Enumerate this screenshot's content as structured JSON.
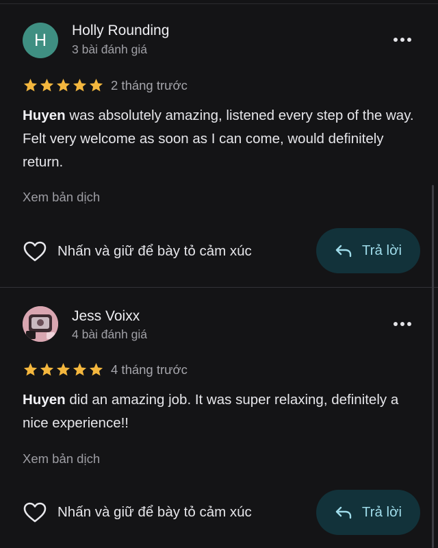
{
  "colors": {
    "background": "#141416",
    "star": "#f4b73e",
    "reply_bg": "#12323a",
    "reply_text": "#9fdcea",
    "avatar_letter_bg": "#3f8f82"
  },
  "reviews": [
    {
      "avatar_letter": "H",
      "name": "Holly Rounding",
      "review_count": "3 bài đánh giá",
      "rating": 5,
      "time_ago": "2 tháng trước",
      "text_bold": "Huyen",
      "text_rest": " was absolutely amazing, listened every step of the way. Felt very welcome as soon as I can come, would definitely return.",
      "translate_label": "Xem bản dịch",
      "react_label": "Nhấn và giữ để bày tỏ cảm xúc",
      "reply_label": "Trả lời"
    },
    {
      "avatar_letter": "",
      "name": "Jess Voixx",
      "review_count": "4 bài đánh giá",
      "rating": 5,
      "time_ago": "4 tháng trước",
      "text_bold": "Huyen",
      "text_rest": " did an amazing job. It was super relaxing, definitely a nice experience!!",
      "translate_label": "Xem bản dịch",
      "react_label": "Nhấn và giữ để bày tỏ cảm xúc",
      "reply_label": "Trả lời"
    }
  ],
  "icons": {
    "more": "more-vert-icon",
    "heart": "heart-outline-icon",
    "reply": "reply-arrow-icon",
    "star": "star-icon"
  }
}
